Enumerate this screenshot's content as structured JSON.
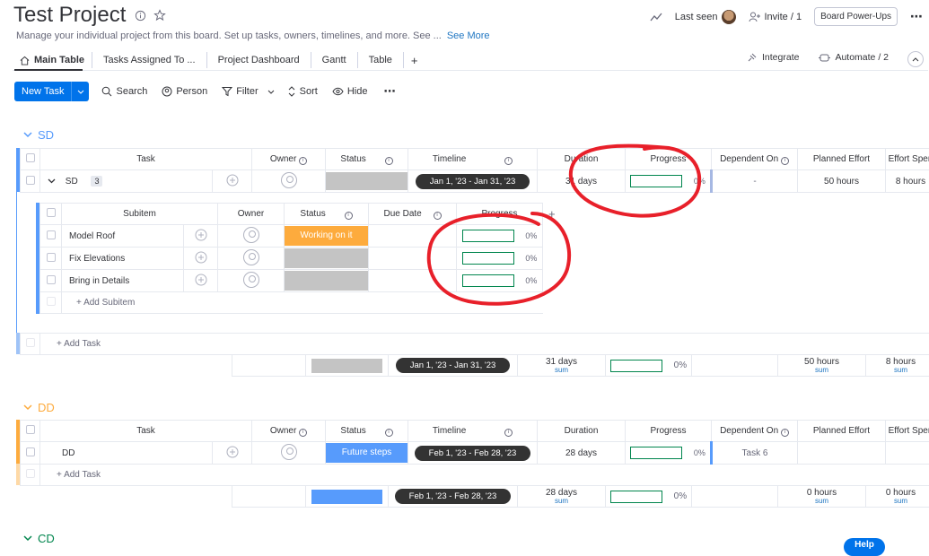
{
  "header": {
    "title": "Test Project",
    "description": "Manage your individual project from this board. Set up tasks, owners, timelines, and more. See ...",
    "see_more": "See More",
    "last_seen": "Last seen",
    "invite": "Invite / 1",
    "power_ups": "Board Power-Ups"
  },
  "tabs": [
    {
      "label": "Main Table"
    },
    {
      "label": "Tasks Assigned To ..."
    },
    {
      "label": "Project Dashboard"
    },
    {
      "label": "Gantt"
    },
    {
      "label": "Table"
    },
    {
      "label": "+"
    }
  ],
  "right_tools": {
    "integrate": "Integrate",
    "automate": "Automate / 2"
  },
  "toolbar": {
    "new_task": "New Task",
    "search": "Search",
    "person": "Person",
    "filter": "Filter",
    "sort": "Sort",
    "hide": "Hide"
  },
  "columns": {
    "task": "Task",
    "owner": "Owner",
    "status": "Status",
    "timeline": "Timeline",
    "duration": "Duration",
    "progress": "Progress",
    "dependent_on": "Dependent On",
    "planned_effort": "Planned Effort",
    "effort_spent": "Effort Spen"
  },
  "sub_columns": {
    "subitem": "Subitem",
    "owner": "Owner",
    "status": "Status",
    "due_date": "Due Date",
    "progress": "Progress"
  },
  "colors": {
    "sd": "#579bfc",
    "sd_stripe": "#579bfc",
    "dd": "#fdab3d",
    "working": "#fdab3d",
    "future": "#579bfc",
    "empty_status": "#c4c4c4"
  },
  "groups": {
    "sd": {
      "name": "SD",
      "task": {
        "name": "SD",
        "count": "3",
        "timeline": "Jan 1, '23 - Jan 31, '23",
        "duration": "31 days",
        "progress": "0%",
        "dependent": "-",
        "planned": "50 hours",
        "spent": "8 hours"
      },
      "subitems": [
        {
          "name": "Model Roof",
          "status": "Working on it",
          "progress": "0%"
        },
        {
          "name": "Fix Elevations",
          "status": "",
          "progress": "0%"
        },
        {
          "name": "Bring in Details",
          "status": "",
          "progress": "0%"
        }
      ],
      "add_subitem": "+ Add Subitem",
      "add_task": "+ Add Task",
      "summary": {
        "timeline": "Jan 1, '23 - Jan 31, '23",
        "duration": "31 days",
        "duration_sub": "sum",
        "progress": "0%",
        "planned": "50 hours",
        "planned_sub": "sum",
        "spent": "8 hours",
        "spent_sub": "sum"
      }
    },
    "dd": {
      "name": "DD",
      "task": {
        "name": "DD",
        "status": "Future steps",
        "timeline": "Feb 1, '23 - Feb 28, '23",
        "duration": "28 days",
        "progress": "0%",
        "dependent": "Task 6"
      },
      "add_task": "+ Add Task",
      "summary": {
        "timeline": "Feb 1, '23 - Feb 28, '23",
        "duration": "28 days",
        "duration_sub": "sum",
        "progress": "0%",
        "planned": "0 hours",
        "planned_sub": "sum",
        "spent": "0 hours",
        "spent_sub": "sum"
      }
    },
    "cd": {
      "name": "CD"
    }
  },
  "help": "Help"
}
